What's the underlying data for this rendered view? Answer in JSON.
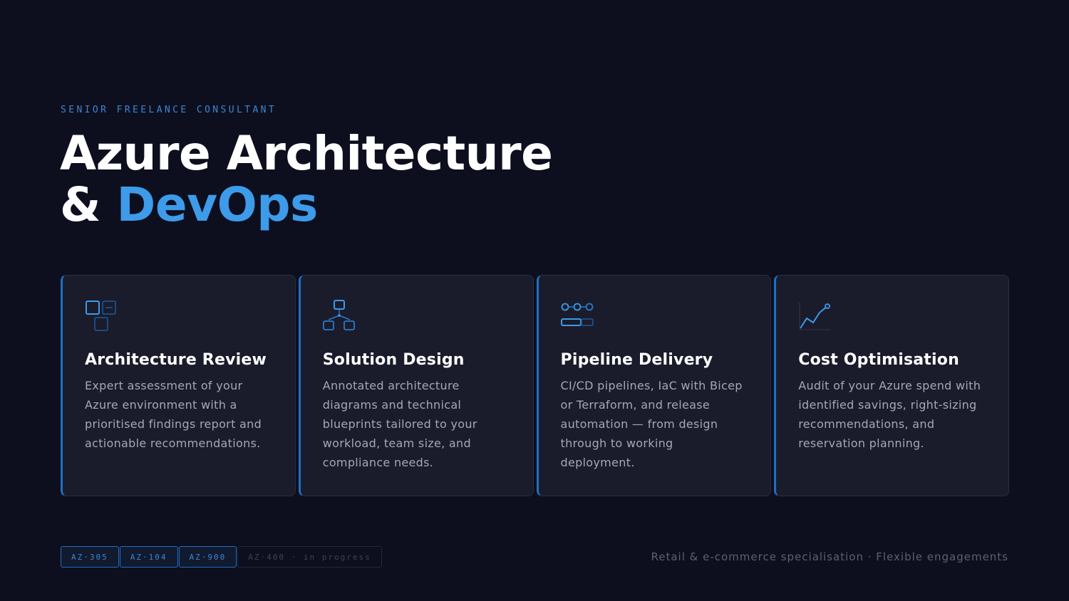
{
  "hero": {
    "eyebrow": "SENIOR FREELANCE CONSULTANT",
    "title_line1": "Azure Architecture",
    "title_amp": "&",
    "title_accent": "DevOps"
  },
  "cards": [
    {
      "icon": "grid-squares-icon",
      "title": "Architecture Review",
      "description": "Expert assessment of your Azure environment with a prioritised findings report and actionable recommendations."
    },
    {
      "icon": "hierarchy-diagram-icon",
      "title": "Solution Design",
      "description": "Annotated architecture diagrams and technical blueprints tailored to your workload, team size, and compliance needs."
    },
    {
      "icon": "pipeline-icon",
      "title": "Pipeline Delivery",
      "description": "CI/CD pipelines, IaC with Bicep or Terraform, and release automation — from design through to working deployment."
    },
    {
      "icon": "trend-chart-icon",
      "title": "Cost Optimisation",
      "description": "Audit of your Azure spend with identified savings, right-sizing recommendations, and reservation planning."
    }
  ],
  "certifications": [
    {
      "label": "AZ·305",
      "status": "active"
    },
    {
      "label": "AZ·104",
      "status": "active"
    },
    {
      "label": "AZ·900",
      "status": "active"
    },
    {
      "label": "AZ·400 · in progress",
      "status": "pending"
    }
  ],
  "footer": {
    "tagline": "Retail & e-commerce specialisation · Flexible engagements"
  },
  "colors": {
    "background": "#0d0f1f",
    "accent": "#3d9be9",
    "card_bg": "#1a1c2c",
    "card_border_accent": "#1f6fc4"
  }
}
